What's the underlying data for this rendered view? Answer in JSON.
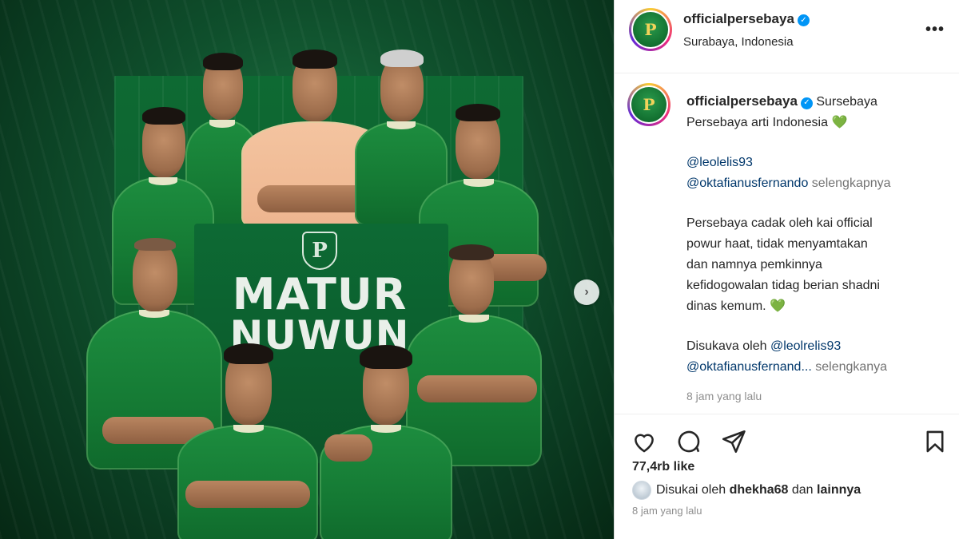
{
  "media": {
    "headline_line1": "MATUR",
    "headline_line2": "NUWUN",
    "crest_letter": "P",
    "next_icon": "chevron-right-icon"
  },
  "post_header": {
    "username": "officialpersebaya",
    "verified_icon": "verified-badge-icon",
    "location": "Surabaya, Indonesia",
    "more_icon": "more-options-icon",
    "more_label": "•••"
  },
  "caption": {
    "username": "officialpersebaya",
    "first_line": "Sursebaya",
    "second_line": "Persebaya arti Indonesia",
    "heart_emoji": "💚",
    "mention_1": "@leolelis93",
    "mention_2": "@oktafianusfernando",
    "see_more_1": "selengkapnya",
    "paragraph_lines": [
      "Persebaya cadak oleh kai official",
      "powur haat, tidak menyamtakan",
      "dan namnya pemkinnya",
      "kefidogowalan tidag berian shadni",
      "dinas kemum."
    ],
    "liked_prefix": "Disukava oleh",
    "liked_mention_1": "@leolrelis93",
    "liked_mention_2": "@oktafianusfernand...",
    "see_more_2": "selengkanya",
    "time": "8 jam yang lalu"
  },
  "actions": {
    "like_icon": "heart-icon",
    "comment_icon": "comment-icon",
    "share_icon": "share-icon",
    "save_icon": "bookmark-icon"
  },
  "footer": {
    "likes_count": "77,4rb like",
    "liked_by_prefix": "Disukai oleh",
    "liked_by_user": "dhekha68",
    "liked_by_conj": "dan",
    "liked_by_others": "lainnya",
    "time": "8 jam yang lalu"
  },
  "colors": {
    "media_green": "#0f4f2c",
    "jersey_green": "#157a34",
    "link_blue": "#00376b",
    "verified_blue": "#0095f6"
  }
}
